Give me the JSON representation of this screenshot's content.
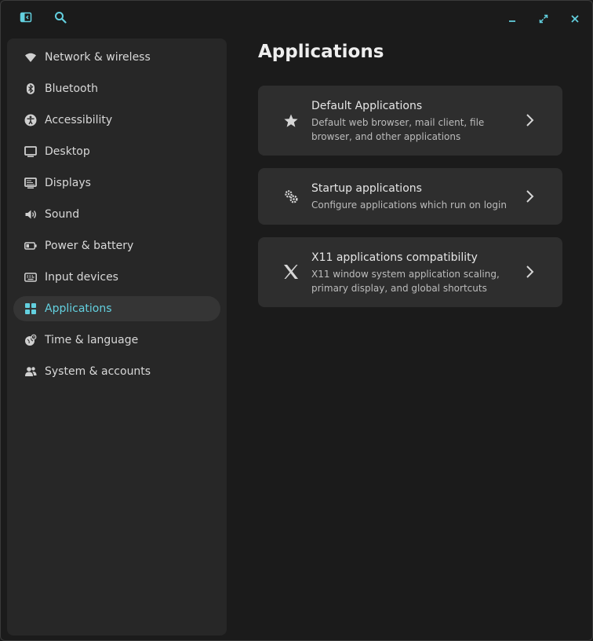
{
  "header": {
    "sidebar_toggle_icon": "sidebar-toggle-icon",
    "search_icon": "search-icon",
    "window_controls": [
      "minimize-icon",
      "maximize-icon",
      "close-icon"
    ]
  },
  "sidebar": {
    "items": [
      {
        "label": "Network & wireless",
        "icon": "wifi-icon"
      },
      {
        "label": "Bluetooth",
        "icon": "bluetooth-icon"
      },
      {
        "label": "Accessibility",
        "icon": "accessibility-icon"
      },
      {
        "label": "Desktop",
        "icon": "monitor-icon"
      },
      {
        "label": "Displays",
        "icon": "display-icon"
      },
      {
        "label": "Sound",
        "icon": "speaker-icon"
      },
      {
        "label": "Power & battery",
        "icon": "battery-icon"
      },
      {
        "label": "Input devices",
        "icon": "keyboard-icon"
      },
      {
        "label": "Applications",
        "icon": "apps-grid-icon",
        "active": true
      },
      {
        "label": "Time & language",
        "icon": "globe-clock-icon"
      },
      {
        "label": "System & accounts",
        "icon": "users-icon"
      }
    ]
  },
  "main": {
    "title": "Applications",
    "cards": [
      {
        "title": "Default Applications",
        "description": "Default web browser, mail client, file browser, and other applications",
        "icon": "star-icon"
      },
      {
        "title": "Startup applications",
        "description": "Configure applications which run on login",
        "icon": "gears-icon"
      },
      {
        "title": "X11 applications compatibility",
        "description": "X11 window system application scaling, primary display, and global shortcuts",
        "icon": "x11-icon"
      }
    ]
  },
  "colors": {
    "accent": "#63d0df",
    "window_bg": "#1b1b1b",
    "sidebar_bg": "#272727",
    "card_bg": "#2e2e2e",
    "active_item_bg": "#353535"
  }
}
